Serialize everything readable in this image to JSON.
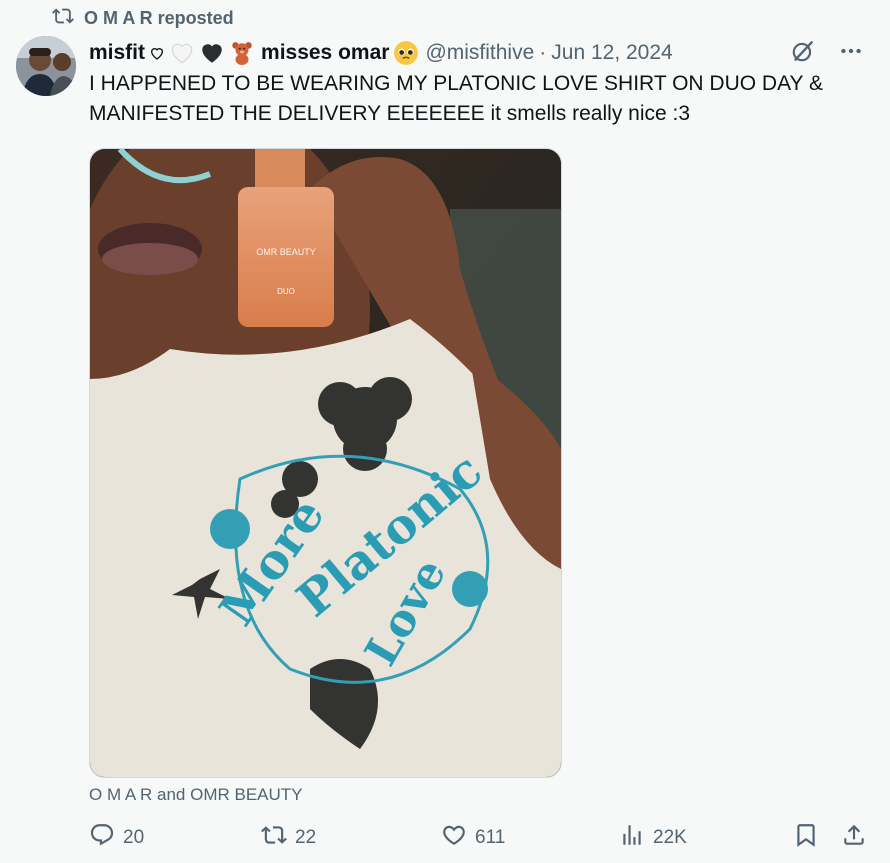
{
  "repost": {
    "icon": "repost-icon",
    "label": "O M A R reposted"
  },
  "author": {
    "name_prefix": "misfit",
    "name_suffix": "misses omar",
    "handle": "@misfithive",
    "separator": "·",
    "date": "Jun 12, 2024",
    "emojis": [
      "white-heart-outline-icon",
      "white-heart-icon",
      "black-heart-icon",
      "teddy-bear-icon",
      "pleading-face-icon"
    ]
  },
  "tweet": {
    "text": "I HAPPENED TO BE WEARING MY PLATONIC LOVE SHIRT ON DUO DAY & MANIFESTED THE DELIVERY EEEEEEE it smells really nice :3"
  },
  "media": {
    "bottle_brand": "OMR BEAUTY",
    "bottle_name": "DUO",
    "shirt_text": [
      "More",
      "Platonic",
      "Love"
    ]
  },
  "tagged": "O M A R and OMR BEAUTY",
  "actions": {
    "replies": "20",
    "reposts": "22",
    "likes": "611",
    "views": "22K"
  },
  "colors": {
    "muted": "#536471",
    "text": "#0f1419",
    "background": "#f7f8f8",
    "shirt_teal": "#2a9cb4"
  }
}
